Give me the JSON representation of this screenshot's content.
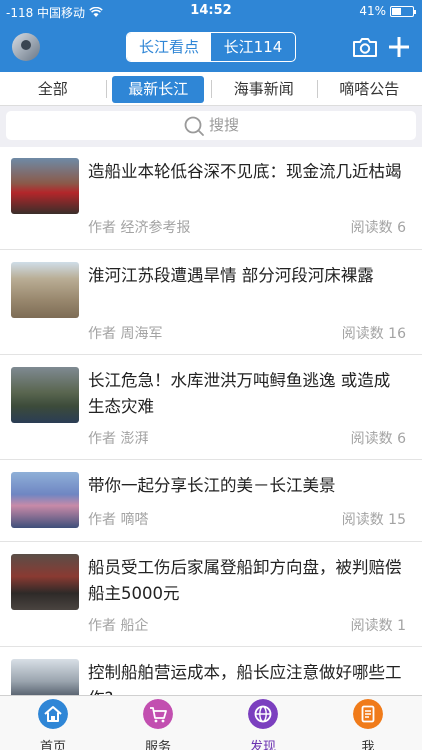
{
  "status": {
    "carrier": "-118 中国移动",
    "time": "14:52",
    "battery": "41%"
  },
  "header": {
    "segments": [
      {
        "label": "长江看点"
      },
      {
        "label": "长江114"
      }
    ],
    "camera_icon": "camera-icon",
    "add_icon": "plus-icon"
  },
  "tabs": [
    {
      "label": "全部"
    },
    {
      "label": "最新长江"
    },
    {
      "label": "海事新闻"
    },
    {
      "label": "嘀嗒公告"
    }
  ],
  "search": {
    "placeholder": "搜搜"
  },
  "articles": [
    {
      "title": "造船业本轮低谷深不见底：现金流几近枯竭",
      "author": "作者 经济参考报",
      "reads": "阅读数 6"
    },
    {
      "title": "淮河江苏段遭遇旱情 部分河段河床裸露",
      "author": "作者 周海军",
      "reads": "阅读数 16"
    },
    {
      "title": "长江危急！水库泄洪万吨鲟鱼逃逸 或造成生态灾难",
      "author": "作者 澎湃",
      "reads": "阅读数 6"
    },
    {
      "title": "带你一起分享长江的美－长江美景",
      "author": "作者 嘀嗒",
      "reads": "阅读数 15"
    },
    {
      "title": "船员受工伤后家属登船卸方向盘，被判赔偿船主5000元",
      "author": "作者 船企",
      "reads": "阅读数 1"
    },
    {
      "title": "控制船舶营运成本，船长应注意做好哪些工作?",
      "author": "",
      "reads": ""
    }
  ],
  "tabbar": [
    {
      "label": "首页",
      "icon": "home-icon",
      "color": "#2f86d6"
    },
    {
      "label": "服务",
      "icon": "cart-icon",
      "color": "#c24fb0"
    },
    {
      "label": "发现",
      "icon": "globe-icon",
      "color": "#7b3fbf"
    },
    {
      "label": "我",
      "icon": "document-icon",
      "color": "#f07b1a"
    }
  ]
}
